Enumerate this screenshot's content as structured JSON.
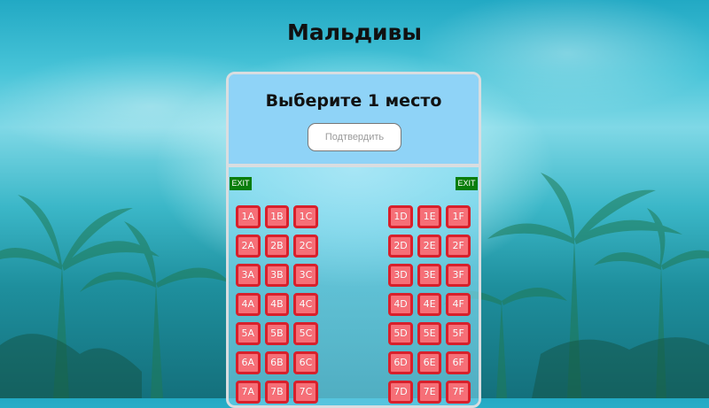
{
  "page": {
    "title": "Мальдивы"
  },
  "panel": {
    "heading": "Выберите 1 место",
    "confirm_label": "Подтвердить"
  },
  "cabin": {
    "exit_left": "EXIT",
    "exit_right": "EXIT",
    "rows": [
      {
        "row": "1",
        "seats": [
          "1A",
          "1B",
          "1C",
          "1D",
          "1E",
          "1F"
        ]
      },
      {
        "row": "2",
        "seats": [
          "2A",
          "2B",
          "2C",
          "2D",
          "2E",
          "2F"
        ]
      },
      {
        "row": "3",
        "seats": [
          "3A",
          "3B",
          "3C",
          "3D",
          "3E",
          "3F"
        ]
      },
      {
        "row": "4",
        "seats": [
          "4A",
          "4B",
          "4C",
          "4D",
          "4E",
          "4F"
        ]
      },
      {
        "row": "5",
        "seats": [
          "5A",
          "5B",
          "5C",
          "5D",
          "5E",
          "5F"
        ]
      },
      {
        "row": "6",
        "seats": [
          "6A",
          "6B",
          "6C",
          "6D",
          "6E",
          "6F"
        ]
      },
      {
        "row": "7",
        "seats": [
          "7A",
          "7B",
          "7C",
          "7D",
          "7E",
          "7F"
        ]
      }
    ],
    "seat_color": "#f66f77",
    "seat_border_color": "#d8202b"
  }
}
